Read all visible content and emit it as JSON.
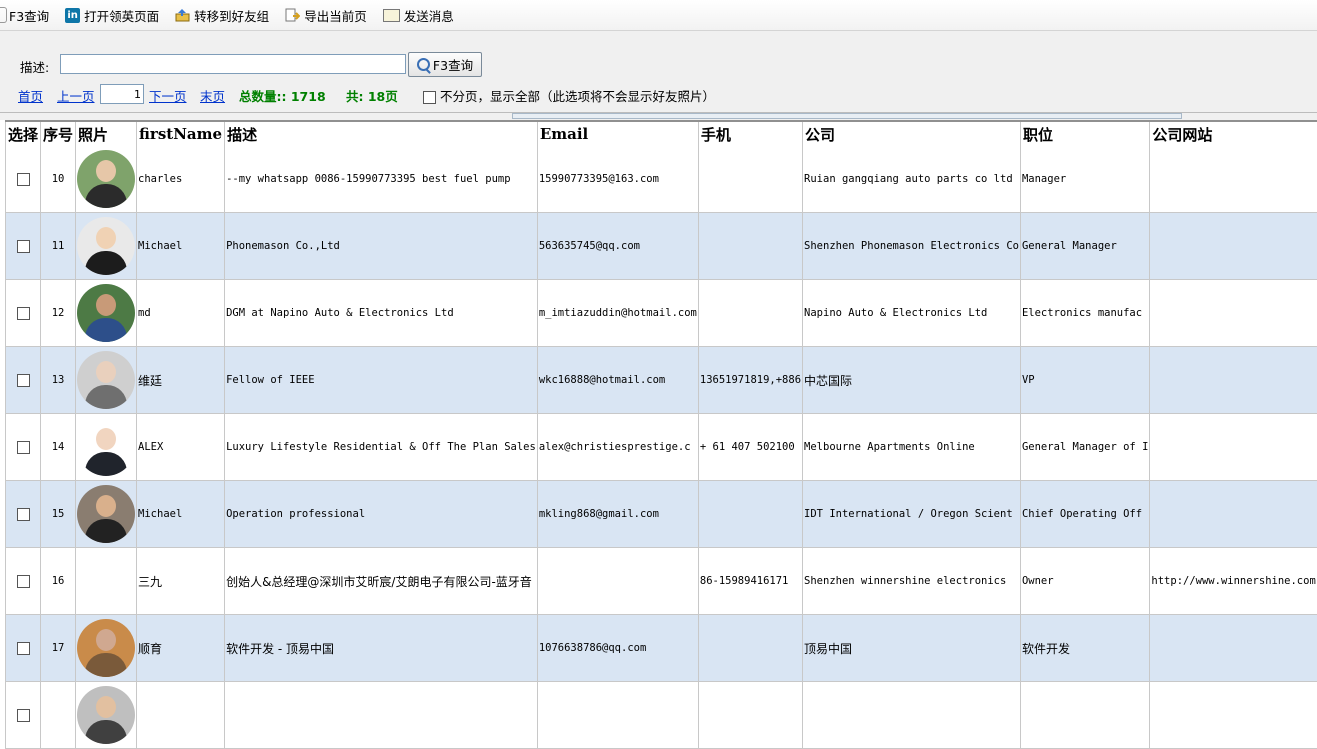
{
  "toolbar": {
    "items": [
      {
        "label": "F3查询",
        "icon": "search-icon"
      },
      {
        "label": "打开领英页面",
        "icon": "linkedin-icon"
      },
      {
        "label": "转移到好友组",
        "icon": "move-to-group-icon"
      },
      {
        "label": "导出当前页",
        "icon": "export-icon"
      },
      {
        "label": "发送消息",
        "icon": "message-icon"
      }
    ]
  },
  "search": {
    "desc_label": "描述:",
    "desc_value": "",
    "button_label": "F3查询"
  },
  "pager": {
    "first": "首页",
    "prev": "上一页",
    "page": "1",
    "next": "下一页",
    "last": "末页",
    "total_label": "总数量::",
    "total": "1718",
    "pages_label": "共:",
    "pages": "18页",
    "show_all_label": "不分页，显示全部（此选项将不会显示好友照片）"
  },
  "table": {
    "columns": [
      "选择",
      "序号",
      "照片",
      "firstName",
      "描述",
      "Email",
      "手机",
      "公司",
      "职位",
      "公司网站"
    ],
    "rows": [
      {
        "seq": "10",
        "first": "charles",
        "desc": "--my whatsapp 0086-15990773395 best fuel pump",
        "email": "15990773395@163.com",
        "phone": "",
        "company": "Ruian gangqiang auto parts co ltd",
        "title": "Manager",
        "site": "",
        "photo": true
      },
      {
        "seq": "11",
        "first": "Michael",
        "desc": "Phonemason Co.,Ltd",
        "email": "563635745@qq.com",
        "phone": "",
        "company": "Shenzhen Phonemason Electronics Co",
        "title": "General Manager",
        "site": "",
        "photo": true
      },
      {
        "seq": "12",
        "first": "md",
        "desc": "DGM at Napino Auto & Electronics Ltd",
        "email": "m_imtiazuddin@hotmail.com",
        "phone": "",
        "company": "Napino Auto & Electronics Ltd",
        "title": "Electronics manufac",
        "site": "",
        "photo": true
      },
      {
        "seq": "13",
        "first": "维廷",
        "desc": "Fellow of IEEE",
        "email": "wkc16888@hotmail.com",
        "phone": "13651971819,+886",
        "company": "中芯国际",
        "title": "VP",
        "site": "",
        "photo": true
      },
      {
        "seq": "14",
        "first": "ALEX",
        "desc": "Luxury Lifestyle Residential & Off The Plan Sales",
        "email": "alex@christiesprestige.c",
        "phone": "+ 61 407 502100",
        "company": "Melbourne Apartments Online",
        "title": "General Manager of I",
        "site": "",
        "photo": true
      },
      {
        "seq": "15",
        "first": "Michael",
        "desc": "Operation professional",
        "email": "mkling868@gmail.com",
        "phone": "",
        "company": "IDT International / Oregon Scient",
        "title": "Chief Operating Off",
        "site": "",
        "photo": true
      },
      {
        "seq": "16",
        "first": "三九",
        "desc": "创始人&总经理@深圳市艾昕宸/艾朗电子有限公司-蓝牙音",
        "email": "",
        "phone": "86-15989416171",
        "company": "Shenzhen winnershine electronics",
        "title": "Owner",
        "site": "http://www.winnershine.com",
        "photo": false
      },
      {
        "seq": "17",
        "first": "顺育",
        "desc": "软件开发 - 顶易中国",
        "email": "1076638786@qq.com",
        "phone": "",
        "company": "顶易中国",
        "title": "软件开发",
        "site": "",
        "photo": true
      },
      {
        "seq": "",
        "first": "",
        "desc": "",
        "email": "",
        "phone": "",
        "company": "",
        "title": "",
        "site": "",
        "photo": true
      }
    ]
  },
  "colors": {
    "alt_row": "#d9e5f3",
    "link": "#0033cc",
    "stat": "#008000",
    "header_border": "#909090"
  }
}
